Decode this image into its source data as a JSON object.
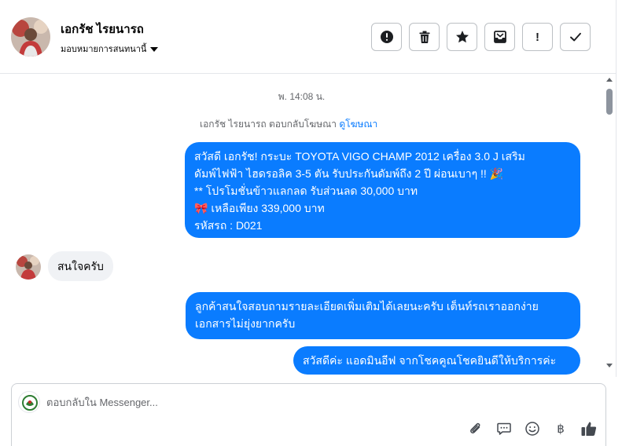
{
  "header": {
    "contact_name": "เอกรัช ไรยนารถ",
    "assign_label": "มอบหมายการสนทนานี้",
    "actions": [
      {
        "name": "alert-circle",
        "label": "!"
      },
      {
        "name": "trash",
        "label": ""
      },
      {
        "name": "star",
        "label": ""
      },
      {
        "name": "archive-inbox",
        "label": ""
      },
      {
        "name": "mark-important",
        "label": "!"
      },
      {
        "name": "checkmark",
        "label": ""
      }
    ]
  },
  "conversation": {
    "timestamp": "พ. 14:08 น.",
    "reply_note_prefix": "เอกรัช ไรยนารถ ตอบกลับโฆษณา",
    "reply_note_link": "ดูโฆษณา",
    "ad_message": {
      "line1": "สวัสดี เอกรัช! กระบะ TOYOTA VIGO CHAMP 2012 เครื่อง 3.0 J เสริม",
      "line2": "ดัมพ์ไฟฟ้า ไฮดรอลิค 3-5 ตัน รับประกันดัมพ์ถึง 2 ปี ผ่อนเบาๆ !! 🎉",
      "line3": "** โปรโมชั่นข้าวแลกลด รับส่วนลด 30,000 บาท",
      "line4": "🎀 เหลือเพียง 339,000 บาท",
      "line5": " รหัสรถ : D021"
    },
    "customer_message": "สนใจครับ",
    "agent_reply_1_line1": "ลูกค้าสนใจสอบถามรายละเอียดเพิ่มเติมได้เลยนะครับ เต็นท์รถเราออกง่าย",
    "agent_reply_1_line2": "เอกสารไม่ยุ่งยากครับ",
    "agent_reply_2": "สวัสดีค่ะ แอดมินอีฟ จากโชคคูณโชคยินดีให้บริการค่ะ"
  },
  "composer": {
    "placeholder": "ตอบกลับใน Messenger...",
    "tools": [
      "paperclip-icon",
      "chat-bubble-icon",
      "emoji-icon",
      "baht-icon",
      "thumbs-up-icon"
    ],
    "baht_symbol": "฿"
  },
  "colors": {
    "accent": "#0a7cff",
    "incoming_bubble": "#f0f2f5",
    "secondary_text": "#65676b"
  }
}
